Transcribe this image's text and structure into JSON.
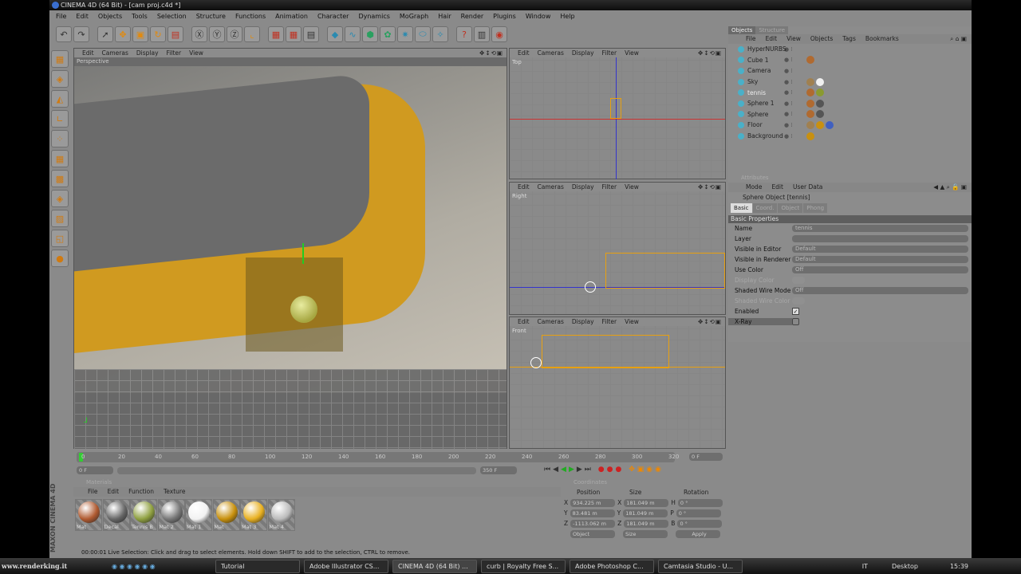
{
  "window": {
    "title": "CINEMA 4D (64 Bit) - [cam proj.c4d *]"
  },
  "menu": [
    "File",
    "Edit",
    "Objects",
    "Tools",
    "Selection",
    "Structure",
    "Functions",
    "Animation",
    "Character",
    "Dynamics",
    "MoGraph",
    "Hair",
    "Render",
    "Plugins",
    "Window",
    "Help"
  ],
  "viewport_menu": [
    "Edit",
    "Cameras",
    "Display",
    "Filter",
    "View"
  ],
  "viewports": {
    "perspective": "Perspective",
    "top": "Top",
    "right": "Right",
    "front": "Front"
  },
  "object_manager": {
    "tabs": [
      "Objects",
      "Structure"
    ],
    "menu": [
      "File",
      "Edit",
      "View",
      "Objects",
      "Tags",
      "Bookmarks"
    ],
    "objects": [
      {
        "name": "HyperNURBS",
        "mats": []
      },
      {
        "name": "Cube 1",
        "mats": [
          "#b06a30"
        ]
      },
      {
        "name": "Camera",
        "mats": []
      },
      {
        "name": "Sky",
        "mats": [
          "#a08050",
          "#f0f0f0"
        ]
      },
      {
        "name": "tennis",
        "mats": [
          "#b06a30",
          "#8a9a30"
        ]
      },
      {
        "name": "Sphere 1",
        "mats": [
          "#b06a30",
          "#555555"
        ]
      },
      {
        "name": "Sphere",
        "mats": [
          "#b06a30",
          "#555555"
        ]
      },
      {
        "name": "Floor",
        "mats": [
          "#a08050",
          "#c89010",
          "#4060c0"
        ]
      },
      {
        "name": "Background",
        "mats": [
          "#c89010"
        ]
      }
    ]
  },
  "attributes": {
    "title": "Attributes",
    "menu": [
      "Mode",
      "Edit",
      "User Data"
    ],
    "object_title": "Sphere Object [tennis]",
    "tabs": [
      "Basic",
      "Coord.",
      "Object",
      "Phong"
    ],
    "section": "Basic Properties",
    "fields": [
      {
        "label": "Name",
        "value": "tennis"
      },
      {
        "label": "Layer",
        "value": ""
      },
      {
        "label": "Visible in Editor",
        "value": "Default"
      },
      {
        "label": "Visible in Renderer",
        "value": "Default"
      },
      {
        "label": "Use Color",
        "value": "Off"
      },
      {
        "label": "Display Color",
        "value": ""
      },
      {
        "label": "Shaded Wire Mode",
        "value": "Off"
      },
      {
        "label": "Shaded Wire Color",
        "value": ""
      }
    ],
    "enabled_label": "Enabled",
    "enabled": true,
    "xray_label": "X-Ray",
    "xray": false
  },
  "timeline": {
    "ticks": [
      "0",
      "20",
      "40",
      "60",
      "80",
      "100",
      "120",
      "140",
      "160",
      "180",
      "200",
      "220",
      "240",
      "260",
      "280",
      "300",
      "320"
    ],
    "current": "0 F",
    "start": "0 F",
    "end": "350 F"
  },
  "materials": {
    "title": "Materials",
    "menu": [
      "File",
      "Edit",
      "Function",
      "Texture"
    ],
    "items": [
      {
        "name": "Mat",
        "color": "#b05a30"
      },
      {
        "name": "Decal",
        "color": "#666666"
      },
      {
        "name": "Tennis B",
        "color": "#8fa040"
      },
      {
        "name": "Mat 2",
        "color": "#777777"
      },
      {
        "name": "Mat 1",
        "color": "#f2f2f2"
      },
      {
        "name": "Mat",
        "color": "#c8900c"
      },
      {
        "name": "Mat 3",
        "color": "#e8b020"
      },
      {
        "name": "Mat 4",
        "color": "#bbbbbb"
      }
    ]
  },
  "coordinates": {
    "title": "Coordinates",
    "headers": [
      "Position",
      "Size",
      "Rotation"
    ],
    "rows": [
      {
        "axis": "X",
        "pos": "934.225 m",
        "saxis": "X",
        "size": "181.049 m",
        "raxis": "H",
        "rot": "0 °"
      },
      {
        "axis": "Y",
        "pos": "83.481 m",
        "saxis": "Y",
        "size": "181.049 m",
        "raxis": "P",
        "rot": "0 °"
      },
      {
        "axis": "Z",
        "pos": "-1113.062 m",
        "saxis": "Z",
        "size": "181.049 m",
        "raxis": "B",
        "rot": "0 °"
      }
    ],
    "mode": "Object",
    "size_mode": "Size",
    "apply": "Apply"
  },
  "status": "00:00:01  Live Selection: Click and drag to select elements. Hold down SHIFT to add to the selection, CTRL to remove.",
  "brand": "MAXON CINEMA 4D",
  "taskbar": {
    "watermark": "www.renderking.it",
    "tasks": [
      "Tutorial",
      "Adobe Illustrator CS...",
      "CINEMA 4D (64 Bit) ...",
      "curb | Royalty Free S...",
      "Adobe Photoshop C...",
      "Camtasia Studio - U..."
    ],
    "lang": "IT",
    "desktop": "Desktop",
    "clock": "15:39"
  }
}
